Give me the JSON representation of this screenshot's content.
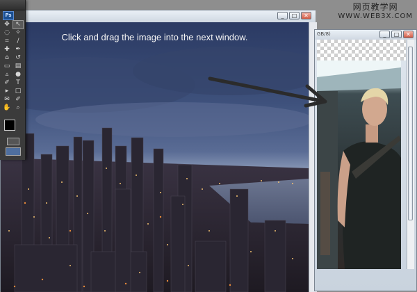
{
  "instruction": "Click and drag the image into the next window.",
  "watermark": {
    "title": "网页教学网",
    "url": "WWW.WEB3X.COM"
  },
  "tools_panel": {
    "logo": "Ps",
    "tools": [
      {
        "name": "move-tool",
        "glyph": "✥",
        "selected": false
      },
      {
        "name": "selection-tool",
        "glyph": "↖",
        "selected": true
      },
      {
        "name": "lasso-tool",
        "glyph": "◌",
        "selected": false
      },
      {
        "name": "magic-wand-tool",
        "glyph": "✧",
        "selected": false
      },
      {
        "name": "crop-tool",
        "glyph": "⌗",
        "selected": false
      },
      {
        "name": "slice-tool",
        "glyph": "∕",
        "selected": false
      },
      {
        "name": "healing-tool",
        "glyph": "✚",
        "selected": false
      },
      {
        "name": "brush-tool",
        "glyph": "✒",
        "selected": false
      },
      {
        "name": "stamp-tool",
        "glyph": "⌂",
        "selected": false
      },
      {
        "name": "history-brush-tool",
        "glyph": "↺",
        "selected": false
      },
      {
        "name": "eraser-tool",
        "glyph": "▭",
        "selected": false
      },
      {
        "name": "gradient-tool",
        "glyph": "▤",
        "selected": false
      },
      {
        "name": "blur-tool",
        "glyph": "▵",
        "selected": false
      },
      {
        "name": "dodge-tool",
        "glyph": "●",
        "selected": false
      },
      {
        "name": "pen-tool",
        "glyph": "✐",
        "selected": false
      },
      {
        "name": "type-tool",
        "glyph": "T",
        "selected": false
      },
      {
        "name": "path-select-tool",
        "glyph": "▸",
        "selected": false
      },
      {
        "name": "shape-tool",
        "glyph": "□",
        "selected": false
      },
      {
        "name": "notes-tool",
        "glyph": "✉",
        "selected": false
      },
      {
        "name": "eyedropper-tool",
        "glyph": "✐",
        "selected": false
      },
      {
        "name": "hand-tool",
        "glyph": "✋",
        "selected": false
      },
      {
        "name": "zoom-tool",
        "glyph": "⌕",
        "selected": false
      }
    ],
    "foreground_color": "#000000",
    "background_color": "#000000"
  },
  "main_window": {
    "controls": [
      "_",
      "□",
      "✕"
    ]
  },
  "second_window": {
    "tab_fragment": "GB/8)",
    "controls": [
      "_",
      "□",
      "✕"
    ]
  },
  "colors": {
    "arrow": "#2b2b2b",
    "window_chrome": "#d4dce6",
    "panel": "#3b3b3b"
  }
}
